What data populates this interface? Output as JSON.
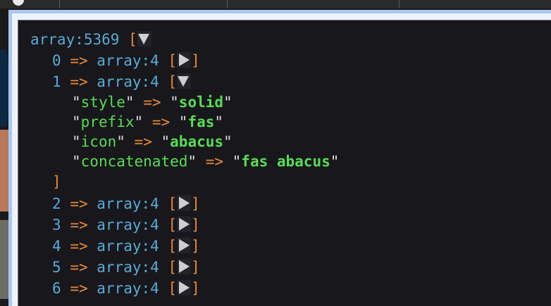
{
  "root": {
    "type_label": "array:5369",
    "open": "["
  },
  "items": [
    {
      "index": "0",
      "arrow": "=>",
      "type_label": "array:4",
      "open": "[",
      "close": "]",
      "expanded": false
    },
    {
      "index": "1",
      "arrow": "=>",
      "type_label": "array:4",
      "open": "[",
      "expanded": true,
      "children": [
        {
          "key": "style",
          "arrow": "=>",
          "value": "solid"
        },
        {
          "key": "prefix",
          "arrow": "=>",
          "value": "fas"
        },
        {
          "key": "icon",
          "arrow": "=>",
          "value": "abacus"
        },
        {
          "key": "concatenated",
          "arrow": "=>",
          "value": "fas abacus"
        }
      ],
      "close": "]"
    },
    {
      "index": "2",
      "arrow": "=>",
      "type_label": "array:4",
      "open": "[",
      "close": "]",
      "expanded": false
    },
    {
      "index": "3",
      "arrow": "=>",
      "type_label": "array:4",
      "open": "[",
      "close": "]",
      "expanded": false
    },
    {
      "index": "4",
      "arrow": "=>",
      "type_label": "array:4",
      "open": "[",
      "close": "]",
      "expanded": false
    },
    {
      "index": "5",
      "arrow": "=>",
      "type_label": "array:4",
      "open": "[",
      "close": "]",
      "expanded": false
    },
    {
      "index": "6",
      "arrow": "=>",
      "type_label": "array:4",
      "open": "[",
      "close": "]",
      "expanded": false
    }
  ],
  "icons": {
    "collapsed": "caret-right-icon",
    "expanded": "caret-down-icon"
  },
  "colors": {
    "type": "#56acd6",
    "arrow": "#e88a3b",
    "key": "#56dd55",
    "value": "#56dd55",
    "quote": "#dcdcdc",
    "background": "#18171b",
    "frame": "#a9c8ef"
  }
}
